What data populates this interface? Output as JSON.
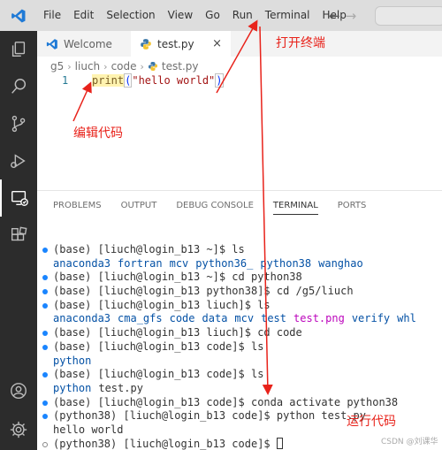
{
  "menu": {
    "items": [
      "File",
      "Edit",
      "Selection",
      "View",
      "Go",
      "Run",
      "Terminal",
      "Help"
    ]
  },
  "tabs": [
    {
      "label": "Welcome"
    },
    {
      "label": "test.py",
      "close": "×"
    }
  ],
  "breadcrumb": [
    "g5",
    "liuch",
    "code",
    "test.py"
  ],
  "editor": {
    "line_number": "1",
    "code_fn": "print",
    "code_open": "(",
    "code_str": "\"hello world\"",
    "code_close": ")"
  },
  "panel": {
    "tabs": [
      "PROBLEMS",
      "OUTPUT",
      "DEBUG CONSOLE",
      "TERMINAL",
      "PORTS"
    ],
    "active_tab": "TERMINAL"
  },
  "terminal": {
    "lines": [
      {
        "kind": "cmd",
        "text": "(base) [liuch@login_b13 ~]$ ls"
      },
      {
        "kind": "list",
        "items": [
          {
            "text": "anaconda3",
            "color": "blue"
          },
          {
            "text": "fortran",
            "color": "blue"
          },
          {
            "text": "mcv",
            "color": "blue"
          },
          {
            "text": "python36_",
            "color": "blue"
          },
          {
            "text": "python38",
            "color": "blue"
          },
          {
            "text": "wanghao",
            "color": "blue"
          }
        ]
      },
      {
        "kind": "cmd",
        "text": "(base) [liuch@login_b13 ~]$ cd python38"
      },
      {
        "kind": "cmd",
        "text": "(base) [liuch@login_b13 python38]$ cd /g5/liuch"
      },
      {
        "kind": "cmd",
        "text": "(base) [liuch@login_b13 liuch]$ ls"
      },
      {
        "kind": "list",
        "items": [
          {
            "text": "anaconda3",
            "color": "blue"
          },
          {
            "text": "cma_gfs",
            "color": "blue"
          },
          {
            "text": "code",
            "color": "blue"
          },
          {
            "text": "data",
            "color": "blue"
          },
          {
            "text": "mcv",
            "color": "blue"
          },
          {
            "text": "test",
            "color": "blue"
          },
          {
            "text": "test.png",
            "color": "magenta"
          },
          {
            "text": "verify",
            "color": "blue"
          },
          {
            "text": "whl",
            "color": "blue"
          }
        ]
      },
      {
        "kind": "cmd",
        "text": "(base) [liuch@login_b13 liuch]$ cd code"
      },
      {
        "kind": "cmd",
        "text": "(base) [liuch@login_b13 code]$ ls"
      },
      {
        "kind": "list",
        "items": [
          {
            "text": "python",
            "color": "blue"
          }
        ]
      },
      {
        "kind": "cmd",
        "text": "(base) [liuch@login_b13 code]$ ls"
      },
      {
        "kind": "list",
        "items": [
          {
            "text": "python",
            "color": "blue"
          },
          {
            "text": "test.py",
            "color": "plain"
          }
        ]
      },
      {
        "kind": "cmd",
        "text": "(base) [liuch@login_b13 code]$ conda activate python38"
      },
      {
        "kind": "cmd",
        "text": "(python38) [liuch@login_b13 code]$ python test.py"
      },
      {
        "kind": "out",
        "text": "hello world"
      },
      {
        "kind": "prompt",
        "text": "(python38) [liuch@login_b13 code]$ "
      }
    ]
  },
  "annotations": {
    "open_terminal": "打开终端",
    "edit_code": "编辑代码",
    "run_code": "运行代码"
  },
  "watermark": "CSDN @刘课华",
  "colors": {
    "annotation_red": "#e8221a",
    "vscode_blue": "#007acc",
    "activity_bar": "#2c2c2c",
    "menu_bar": "#dddddd"
  }
}
